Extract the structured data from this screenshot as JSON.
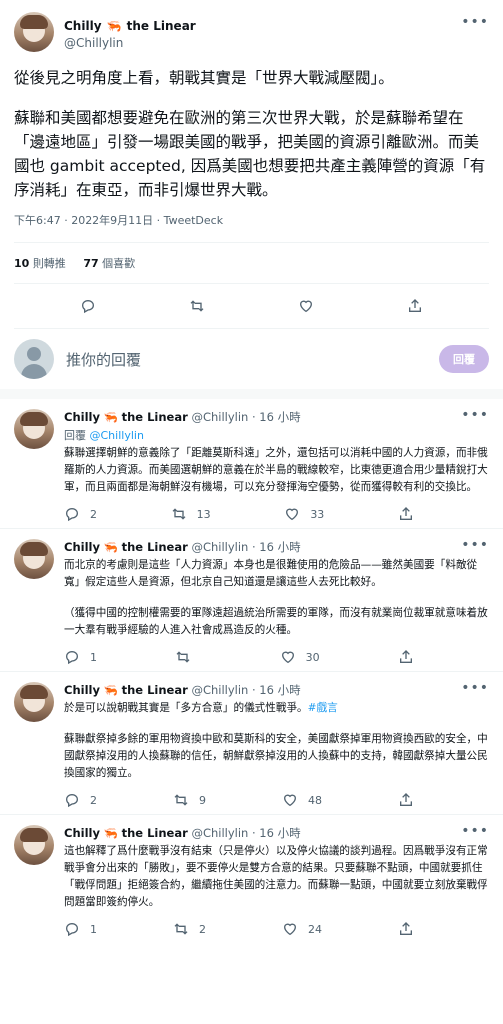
{
  "main_tweet": {
    "display_name": "Chilly",
    "name_suffix": "the Linear",
    "handle": "@Chillylin",
    "para1": "從後見之明角度上看，朝戰其實是「世界大戰減壓閥」。",
    "para2": "蘇聯和美國都想要避免在歐洲的第三次世界大戰，於是蘇聯希望在「邊遠地區」引發一場跟美國的戰爭，把美國的資源引離歐洲。而美國也 gambit accepted, 因爲美國也想要把共產主義陣營的資源「有序消耗」在東亞，而非引爆世界大戰。",
    "meta": "下午6:47 · 2022年9月11日 · TweetDeck",
    "retweets_count": "10",
    "retweets_label": "則轉推",
    "likes_count": "77",
    "likes_label": "個喜歡"
  },
  "composer": {
    "placeholder": "推你的回覆",
    "button_label": "回覆"
  },
  "replies": [
    {
      "display_name": "Chilly",
      "name_suffix": "the Linear",
      "handle_time": "@Chillylin · 16 小時",
      "reply_to_prefix": "回覆",
      "reply_to_handle": "@Chillylin",
      "text": "蘇聯選擇朝鮮的意義除了「距離莫斯科遠」之外，還包括可以消耗中國的人力資源，而非俄羅斯的人力資源。而美國選朝鮮的意義在於半島的戰線較窄，比東德更適合用少量精銳打大軍，而且兩面都是海朝鮮沒有機場，可以充分發揮海空優勢，從而獲得較有利的交換比。",
      "replies": "2",
      "retweets": "13",
      "likes": "33"
    },
    {
      "display_name": "Chilly",
      "name_suffix": "the Linear",
      "handle_time": "@Chillylin · 16 小時",
      "text": "而北京的考慮則是這些「人力資源」本身也是很難使用的危險品——雖然美國要「料敵從寬」假定這些人是資源，但北京自己知道還是讓這些人去死比較好。",
      "text2": "（獲得中國的控制權需要的軍隊遠超過統治所需要的軍隊，而沒有就業崗位裁軍就意味着放一大羣有戰爭經驗的人進入社會成爲造反的火種。",
      "replies": "1",
      "retweets": "",
      "likes": "30"
    },
    {
      "display_name": "Chilly",
      "name_suffix": "the Linear",
      "handle_time": "@Chillylin · 16 小時",
      "text": "於是可以說朝戰其實是「多方合意」的儀式性戰爭。",
      "hashtag": "#戲言",
      "text2": "蘇聯獻祭掉多餘的軍用物資換中歐和莫斯科的安全，美國獻祭掉軍用物資換西歐的安全，中國獻祭掉沒用的人換蘇聯的信任，朝鮮獻祭掉沒用的人換蘇中的支持，韓國獻祭掉大量公民換國家的獨立。",
      "replies": "2",
      "retweets": "9",
      "likes": "48"
    },
    {
      "display_name": "Chilly",
      "name_suffix": "the Linear",
      "handle_time": "@Chillylin · 16 小時",
      "text": "這也解釋了爲什麼戰爭沒有結束（只是停火）以及停火協議的談判過程。因爲戰爭沒有正常戰爭會分出來的「勝敗」，要不要停火是雙方合意的結果。只要蘇聯不點頭，中國就要抓住「戰俘問題」拒絕簽合約，繼續拖住美國的注意力。而蘇聯一點頭，中國就要立刻放棄戰俘問題當即簽約停火。",
      "replies": "1",
      "retweets": "2",
      "likes": "24"
    }
  ]
}
